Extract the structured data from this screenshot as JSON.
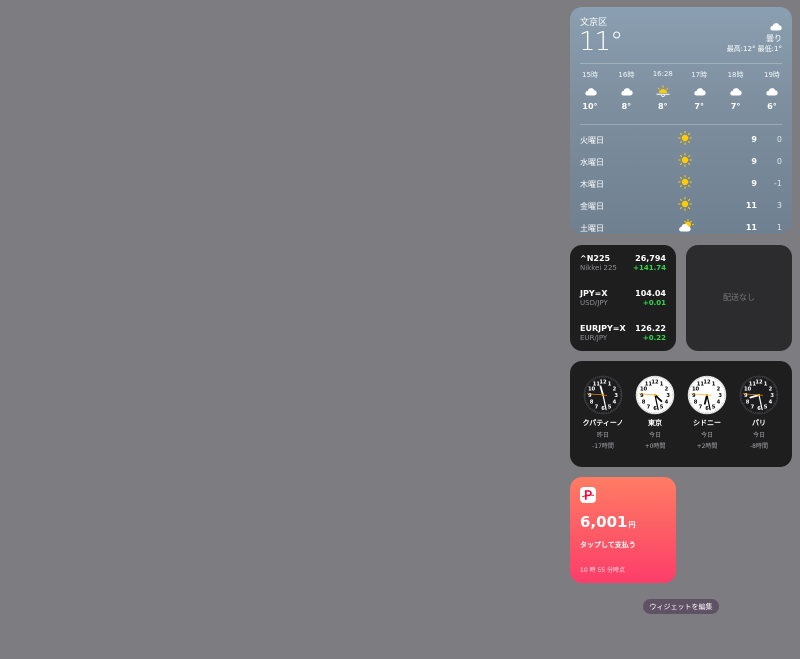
{
  "weather": {
    "city": "文京区",
    "temperature": "11°",
    "condition": "曇り",
    "condition_icon": "cloud-icon",
    "hi_lo": "最高:12° 最低:1°",
    "hourly": [
      {
        "time": "15時",
        "icon": "cloud-icon",
        "temp": "10°"
      },
      {
        "time": "16時",
        "icon": "cloud-icon",
        "temp": "8°"
      },
      {
        "time": "16:28",
        "icon": "sunset-icon",
        "temp": "8°"
      },
      {
        "time": "17時",
        "icon": "cloud-icon",
        "temp": "7°"
      },
      {
        "time": "18時",
        "icon": "cloud-icon",
        "temp": "7°"
      },
      {
        "time": "19時",
        "icon": "cloud-icon",
        "temp": "6°"
      }
    ],
    "daily": [
      {
        "day": "火曜日",
        "icon": "sun-icon",
        "high": "9",
        "low": "0"
      },
      {
        "day": "水曜日",
        "icon": "sun-icon",
        "high": "9",
        "low": "0"
      },
      {
        "day": "木曜日",
        "icon": "sun-icon",
        "high": "9",
        "low": "-1"
      },
      {
        "day": "金曜日",
        "icon": "sun-icon",
        "high": "11",
        "low": "3"
      },
      {
        "day": "土曜日",
        "icon": "partly-cloudy-icon",
        "high": "11",
        "low": "1"
      }
    ]
  },
  "stocks": [
    {
      "symbol": "^N225",
      "name": "Nikkei 225",
      "price": "26,794",
      "change": "+141.74"
    },
    {
      "symbol": "JPY=X",
      "name": "USD/JPY",
      "price": "104.04",
      "change": "+0.01"
    },
    {
      "symbol": "EURJPY=X",
      "name": "EUR/JPY",
      "price": "126.22",
      "change": "+0.22"
    }
  ],
  "deliveries": {
    "message": "配送なし"
  },
  "clocks": [
    {
      "city": "クパティーノ",
      "day": "昨日",
      "offset": "-17時間",
      "hour": 23,
      "minute": 28,
      "dark": true
    },
    {
      "city": "東京",
      "day": "今日",
      "offset": "+0時間",
      "hour": 16,
      "minute": 28,
      "dark": false
    },
    {
      "city": "シドニー",
      "day": "今日",
      "offset": "+2時間",
      "hour": 18,
      "minute": 28,
      "dark": false
    },
    {
      "city": "パリ",
      "day": "今日",
      "offset": "-8時間",
      "hour": 8,
      "minute": 28,
      "dark": true
    }
  ],
  "paypay": {
    "amount": "6,001",
    "unit": "円",
    "action": "タップして支払う",
    "updated": "10 時 55 分時点",
    "logo_icon": "paypay-logo-icon"
  },
  "edit_button": {
    "label": "ウィジェットを編集"
  },
  "colors": {
    "background": "#7d7c80",
    "positive": "#32d74b",
    "sun": "#ffcc00",
    "paypay_red": "#ff0033",
    "clock_second_hand": "#ff9f0a"
  }
}
